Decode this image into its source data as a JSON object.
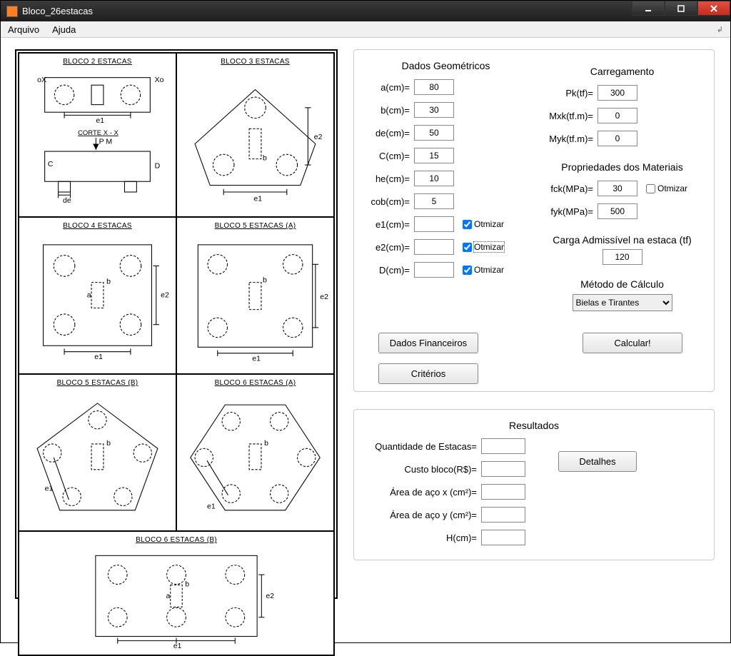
{
  "window_title": "Bloco_26estacas",
  "menu": {
    "file": "Arquivo",
    "help": "Ajuda"
  },
  "diagram_titles": {
    "b2": "BLOCO 2 ESTACAS",
    "b3": "BLOCO 3 ESTACAS",
    "b4": "BLOCO 4 ESTACAS",
    "b5a": "BLOCO 5 ESTACAS (A)",
    "b5b": "BLOCO 5 ESTACAS (B)",
    "b6a": "BLOCO 6 ESTACAS (A)",
    "b6b": "BLOCO 6 ESTACAS (B)",
    "corte": "CORTE X - X"
  },
  "headings": {
    "geom": "Dados Geométricos",
    "load": "Carregamento",
    "mat": "Propriedades dos Materiais",
    "adm": "Carga Admissível na estaca (tf)",
    "method": "Método de Cálculo",
    "results": "Resultados"
  },
  "labels": {
    "a": "a(cm)=",
    "b": "b(cm)=",
    "de": "de(cm)=",
    "C": "C(cm)=",
    "he": "he(cm)=",
    "cob": "cob(cm)=",
    "e1": "e1(cm)=",
    "e2": "e2(cm)=",
    "D": "D(cm)=",
    "Pk": "Pk(tf)=",
    "Mxk": "Mxk(tf.m)=",
    "Myk": "Myk(tf.m)=",
    "fck": "fck(MPa)=",
    "fyk": "fyk(MPa)=",
    "otmizar": "Otmizar"
  },
  "values": {
    "a": "80",
    "b": "30",
    "de": "50",
    "C": "15",
    "he": "10",
    "cob": "5",
    "e1": "",
    "e2": "",
    "D": "",
    "Pk": "300",
    "Mxk": "0",
    "Myk": "0",
    "fck": "30",
    "fyk": "500",
    "adm": "120"
  },
  "checks": {
    "e1": true,
    "e2": true,
    "D": true,
    "fck": false
  },
  "buttons": {
    "financ": "Dados Financeiros",
    "criteria": "Critérios",
    "calc": "Calcular!",
    "details": "Detalhes"
  },
  "method_options": [
    "Bielas e Tirantes"
  ],
  "method_selected": "Bielas e Tirantes",
  "results": {
    "qtd_label": "Quantidade de Estacas=",
    "custo_label": "Custo bloco(R$)=",
    "asx_label": "Área de aço x (cm²)=",
    "asy_label": "Área de aço y (cm²)=",
    "H_label": "H(cm)=",
    "qtd": "",
    "custo": "",
    "asx": "",
    "asy": "",
    "H": ""
  }
}
